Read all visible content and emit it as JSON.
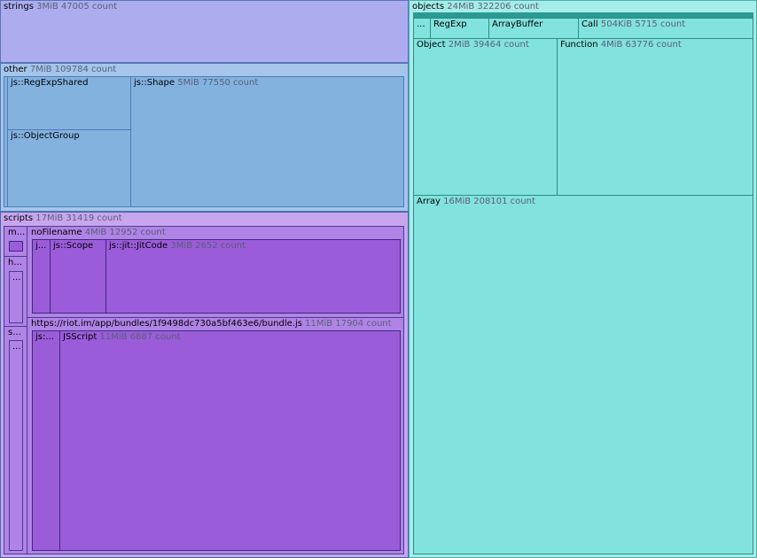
{
  "groups": {
    "strings": {
      "label": "strings",
      "meta": "3MiB 47005 count"
    },
    "other": {
      "label": "other",
      "meta": "7MiB 109784 count",
      "children": {
        "regexpshared": {
          "label": "js::RegExpShared"
        },
        "objectgroup": {
          "label": "js::ObjectGroup"
        },
        "shape": {
          "label": "js::Shape",
          "meta": "5MiB 77550 count"
        }
      }
    },
    "scripts": {
      "label": "scripts",
      "meta": "17MiB 31419 count",
      "children": {
        "m": {
          "label": "m..."
        },
        "h": {
          "label": "h..."
        },
        "h_inner": {
          "label": "..."
        },
        "s": {
          "label": "s..."
        },
        "s_inner": {
          "label": "..."
        },
        "nofilename": {
          "label": "noFilename",
          "meta": "4MiB 12952 count",
          "children": {
            "j": {
              "label": "j..."
            },
            "scope": {
              "label": "js::Scope"
            },
            "jitcode": {
              "label": "js::jit::JitCode",
              "meta": "3MiB 2652 count"
            }
          }
        },
        "bundle": {
          "label": "https://riot.im/app/bundles/1f9498dc730a5bf463e6/bundle.js",
          "meta": "11MiB 17904 count",
          "children": {
            "js": {
              "label": "js:..."
            },
            "jsscript": {
              "label": "JSScript",
              "meta": "11MiB 6887 count"
            }
          }
        }
      }
    },
    "objects": {
      "label": "objects",
      "meta": "24MiB 322206 count",
      "children": {
        "dots": {
          "label": "..."
        },
        "regexp": {
          "label": "RegExp"
        },
        "arraybuffer": {
          "label": "ArrayBuffer"
        },
        "call": {
          "label": "Call",
          "meta": "504KiB 5715 count"
        },
        "object": {
          "label": "Object",
          "meta": "2MiB 39464 count"
        },
        "function": {
          "label": "Function",
          "meta": "4MiB 63776 count"
        },
        "array": {
          "label": "Array",
          "meta": "16MiB 208101 count"
        }
      }
    }
  }
}
